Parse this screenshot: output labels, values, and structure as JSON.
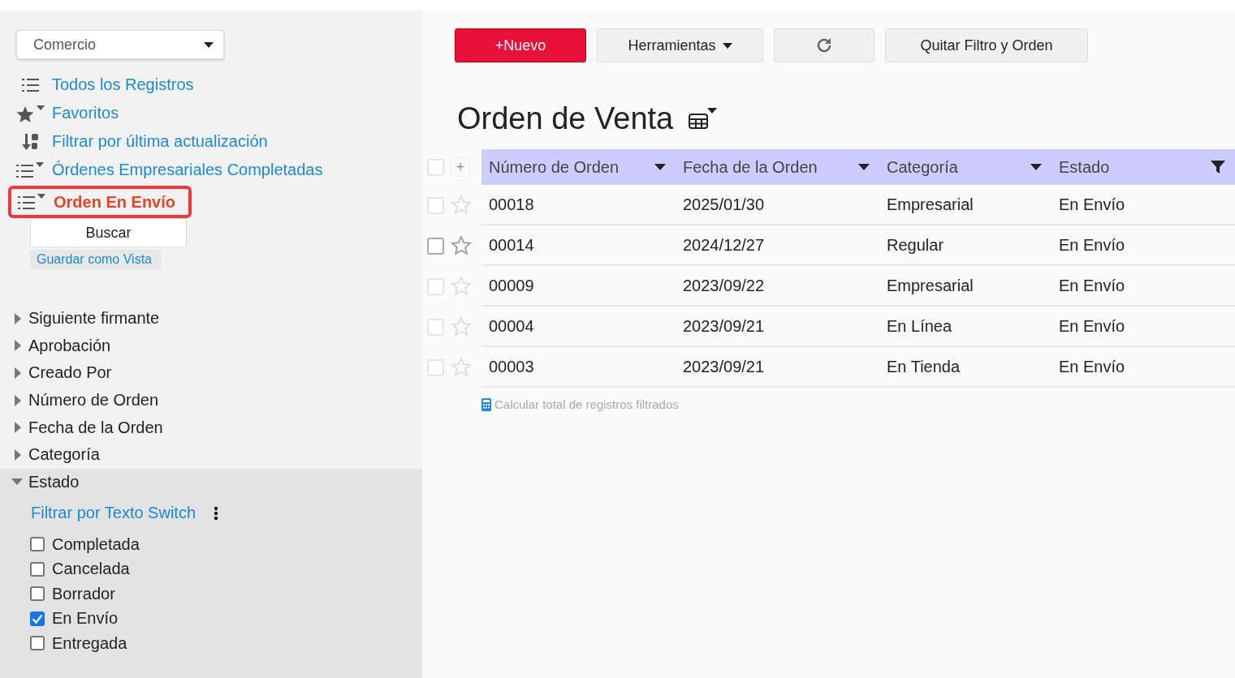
{
  "sidebar": {
    "app_select": {
      "value": "Comercio"
    },
    "views": [
      {
        "label": "Todos los Registros",
        "kind": "list",
        "selected": false
      },
      {
        "label": "Favoritos",
        "kind": "favorites",
        "selected": false
      },
      {
        "label": "Filtrar por última actualización",
        "kind": "sorted",
        "selected": false
      },
      {
        "label": "Órdenes Empresariales Completadas",
        "kind": "filtered",
        "selected": false
      },
      {
        "label": "Orden En Envío",
        "kind": "filtered",
        "selected": true
      }
    ],
    "search_button": "Buscar",
    "save_view_link": "Guardar como Vista",
    "facets": [
      {
        "label": "Siguiente firmante",
        "expanded": false
      },
      {
        "label": "Aprobación",
        "expanded": false
      },
      {
        "label": "Creado Por",
        "expanded": false
      },
      {
        "label": "Número de Orden",
        "expanded": false
      },
      {
        "label": "Fecha de la Orden",
        "expanded": false
      },
      {
        "label": "Categoría",
        "expanded": false
      },
      {
        "label": "Estado",
        "expanded": true,
        "filter_link": "Filtrar por Texto Switch",
        "options": [
          {
            "label": "Completada",
            "checked": false
          },
          {
            "label": "Cancelada",
            "checked": false
          },
          {
            "label": "Borrador",
            "checked": false
          },
          {
            "label": "En Envío",
            "checked": true
          },
          {
            "label": "Entregada",
            "checked": false
          }
        ]
      }
    ]
  },
  "toolbar": {
    "new_button": "+Nuevo",
    "tools_button": "Herramientas",
    "clear_button": "Quitar Filtro y Orden"
  },
  "title": "Orden de Venta",
  "table": {
    "select_all_checked": false,
    "add_column": "+",
    "columns": [
      {
        "label": "Número de Orden",
        "filtered": false
      },
      {
        "label": "Fecha de la Orden",
        "filtered": false
      },
      {
        "label": "Categoría",
        "filtered": false
      },
      {
        "label": "Estado",
        "filtered": true
      }
    ],
    "rows": [
      {
        "cells": [
          "00018",
          "2025/01/30",
          "Empresarial",
          "En Envío"
        ],
        "checked": false,
        "hovered": false
      },
      {
        "cells": [
          "00014",
          "2024/12/27",
          "Regular",
          "En Envío"
        ],
        "checked": false,
        "hovered": true
      },
      {
        "cells": [
          "00009",
          "2023/09/22",
          "Empresarial",
          "En Envío"
        ],
        "checked": false,
        "hovered": false
      },
      {
        "cells": [
          "00004",
          "2023/09/21",
          "En Línea",
          "En Envío"
        ],
        "checked": false,
        "hovered": false
      },
      {
        "cells": [
          "00003",
          "2023/09/21",
          "En Tienda",
          "En Envío"
        ],
        "checked": false,
        "hovered": false
      }
    ]
  },
  "total_link": "Calcular total de registros filtrados"
}
